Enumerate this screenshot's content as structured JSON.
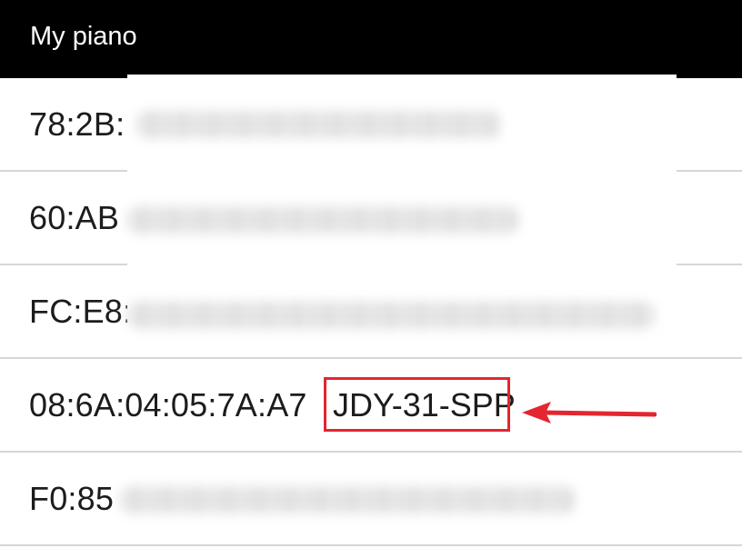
{
  "app": {
    "title": "My piano"
  },
  "devices": [
    {
      "address": "78:2B:",
      "name": ""
    },
    {
      "address": "60:AB",
      "name": ""
    },
    {
      "address": "FC:E8:",
      "name": ""
    },
    {
      "address": "08:6A:04:05:7A:A7",
      "name": "JDY-31-SPP"
    },
    {
      "address": "F0:85",
      "name": ""
    }
  ],
  "annotation": {
    "highlight_color": "#e3262f",
    "icon": "arrow-left-icon"
  },
  "colors": {
    "topbar": "#000000",
    "divider": "#d6d6d6",
    "text": "#1c1c1c"
  }
}
